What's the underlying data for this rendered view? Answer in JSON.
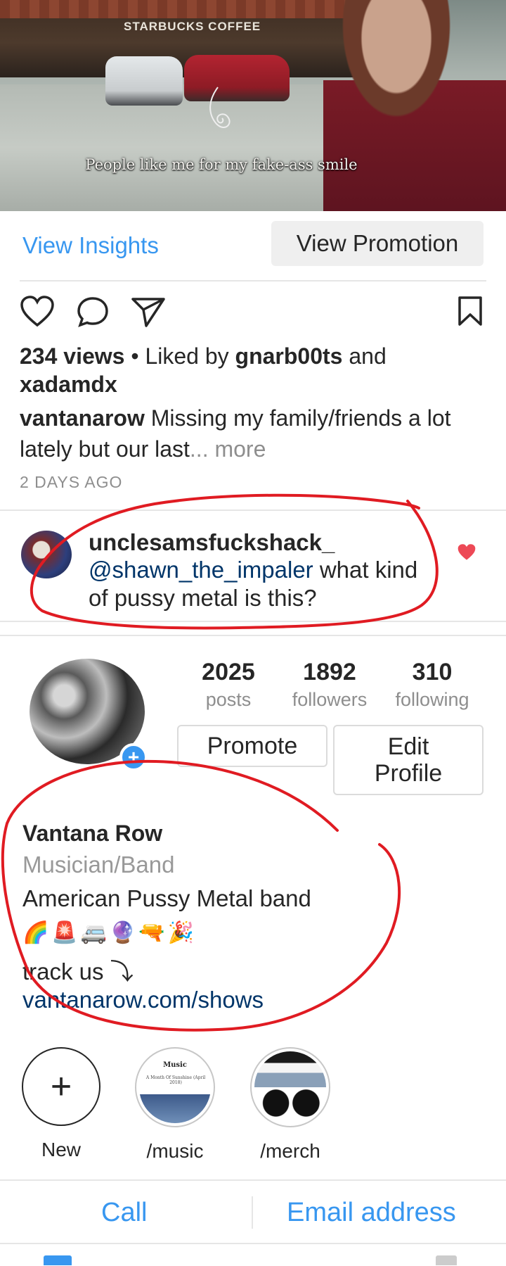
{
  "video": {
    "sign_text": "STARBUCKS COFFEE",
    "subtitle": "People like me for my fake-ass smile"
  },
  "insights": {
    "view_insights_label": "View Insights",
    "view_promotion_label": "View Promotion"
  },
  "post": {
    "views": "234 views",
    "liked_by_prefix": " • Liked by ",
    "liker_1": "gnarb00ts",
    "and": " and",
    "liker_2": "xadamdx",
    "caption_user": "vantanarow",
    "caption_text": " Missing my family/friends a lot lately but our last",
    "more_label": "... more",
    "timestamp": "2 DAYS AGO"
  },
  "comment": {
    "username": "unclesamsfuckshack_",
    "mention": "@shawn_the_impaler",
    "text": " what kind of pussy metal is this?",
    "liked": true
  },
  "profile": {
    "posts_count": "2025",
    "posts_label": "posts",
    "followers_count": "1892",
    "followers_label": "followers",
    "following_count": "310",
    "following_label": "following",
    "promote_label": "Promote",
    "edit_profile_label": "Edit Profile",
    "name": "Vantana Row",
    "category": "Musician/Band",
    "description": "American Pussy Metal band",
    "emojis": "🌈🚨🚐🔮🔫🎉",
    "track_text": "track us ⤵",
    "link": "vantanarow.com/shows"
  },
  "highlights": [
    {
      "label": "New"
    },
    {
      "label": "/music",
      "thumb_text": "Music",
      "thumb_sub": "A Month Of Sunshine (April 2018)"
    },
    {
      "label": "/merch"
    }
  ],
  "contact": {
    "call_label": "Call",
    "email_label": "Email address"
  },
  "colors": {
    "link_blue": "#3897f0",
    "mention_navy": "#003569",
    "annotation_red": "#e01b22",
    "heart_red": "#ed4956"
  }
}
